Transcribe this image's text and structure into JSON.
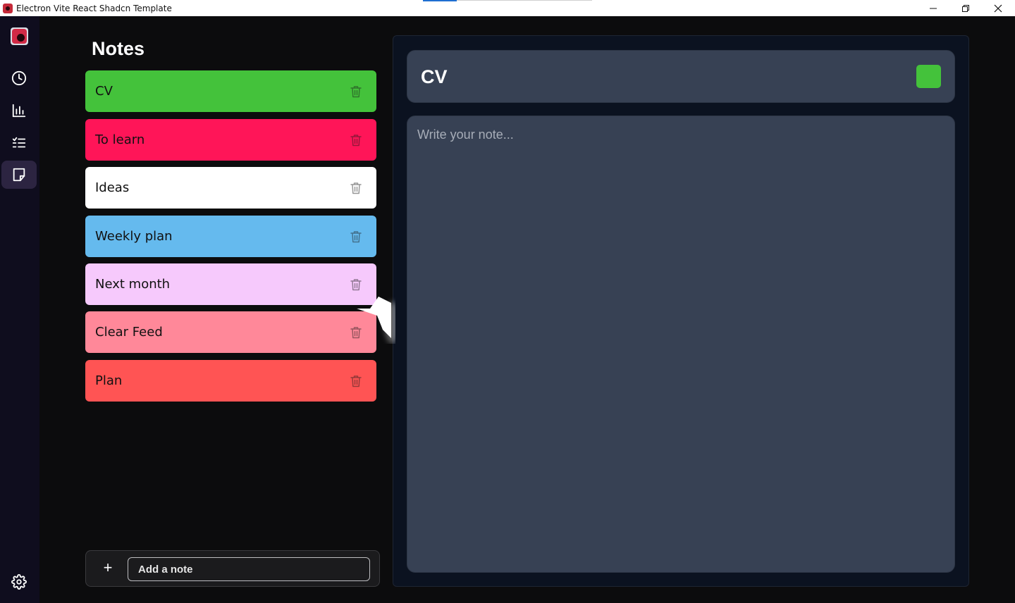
{
  "window": {
    "title": "Electron Vite React Shadcn Template",
    "controls": [
      "minimize",
      "restore",
      "close"
    ]
  },
  "rail": {
    "logo": "app-logo",
    "items": [
      {
        "icon": "clock-icon",
        "active": false
      },
      {
        "icon": "bar-chart-icon",
        "active": false
      },
      {
        "icon": "list-check-icon",
        "active": false
      },
      {
        "icon": "note-icon",
        "active": true
      }
    ],
    "settings_icon": "gear-icon"
  },
  "sidebar": {
    "title": "Notes",
    "notes": [
      {
        "label": "CV",
        "color": "#44c23b"
      },
      {
        "label": "To learn",
        "color": "#ff1558"
      },
      {
        "label": "Ideas",
        "color": "#ffffff"
      },
      {
        "label": "Weekly plan",
        "color": "#65baee"
      },
      {
        "label": "Next month",
        "color": "#f6c9fc"
      },
      {
        "label": "Clear Feed",
        "color": "#ff8899"
      },
      {
        "label": "Plan",
        "color": "#ff5454"
      }
    ],
    "add_note": {
      "placeholder": "Add a note",
      "plus": "+"
    }
  },
  "editor": {
    "title": "CV",
    "swatch_color": "#44c23b",
    "placeholder": "Write your note..."
  },
  "colors": {
    "background": "#0c0c0d",
    "rail": "#0f0d1e",
    "panel": "#374154",
    "accent_active": "#2c2441"
  }
}
